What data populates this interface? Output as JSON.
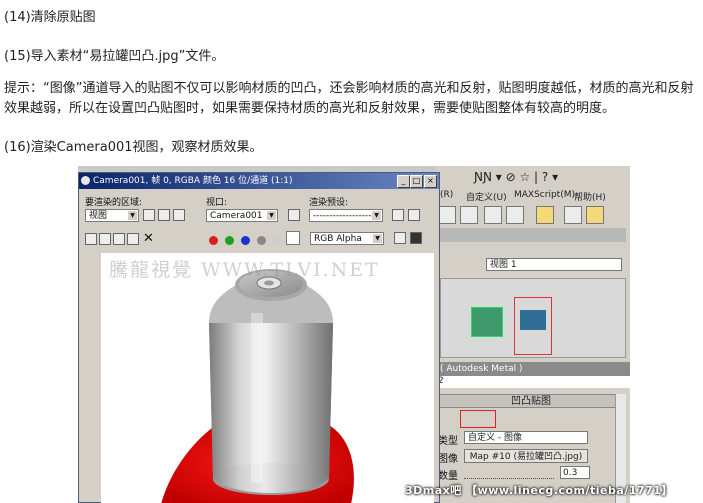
{
  "steps": {
    "s14": "(14)清除原贴图",
    "s15": "(15)导入素材“易拉罐凹凸.jpg”文件。",
    "tip": "提示：“图像”通道导入的贴图不仅可以影响材质的凹凸，还会影响材质的高光和反射，贴图明度越低，材质的高光和反射效果越弱，所以在设置凹凸贴图时，如果需要保持材质的高光和反射效果，需要使贴图整体有较高的明度。",
    "s16": "(16)渲染Camera001视图，观察材质效果。"
  },
  "render_window": {
    "title": "Camera001, 帧 0, RGBA 颜色 16 位/通道 (1:1)",
    "area_label": "要渲染的区域:",
    "area_value": "视图",
    "viewport_label": "视口:",
    "viewport_value": "Camera001",
    "preset_label": "渲染预设:",
    "preset_value": "-------------------",
    "channel_value": "RGB Alpha",
    "watermark": "騰龍視覺 WWW.TLVI.NET",
    "channel_dot_colors": [
      "#d42020",
      "#20a020",
      "#2030c8"
    ]
  },
  "max_window": {
    "toolbar_glyphs": "ƝƝ ▾ ⊘ ☆ | ? ▾",
    "menu": [
      "(R)",
      "自定义(U)",
      "MAXScript(M)",
      "帮助(H)"
    ],
    "viewport_select": "视图 1",
    "autodesk_label": "( Autodesk Metal )",
    "number_field": "2",
    "rollout_title": "凹凸贴图",
    "type_label": "类型",
    "type_value": "自定义 - 图像",
    "image_label": "图像",
    "map_value": "Map #10 (易拉罐凹凸.jpg)",
    "amount_label": "数量",
    "amount_value": "0.3"
  },
  "footer_watermark": "3Dmax吧 【www.linecg.com/tieba/1771】"
}
